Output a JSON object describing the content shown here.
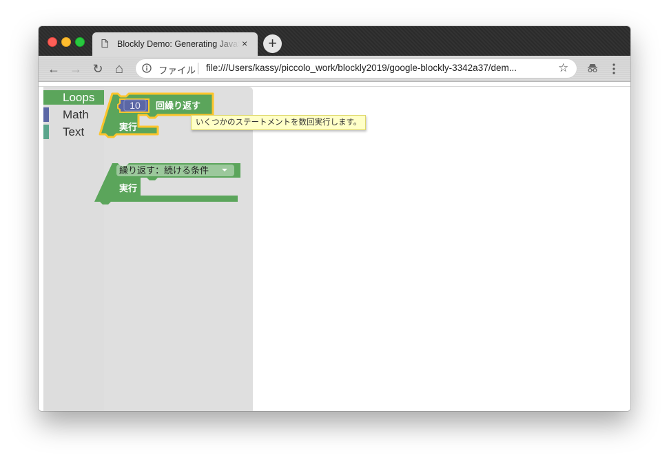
{
  "browser": {
    "tab": {
      "title": "Blockly Demo: Generating JavaScript",
      "close_glyph": "×",
      "icon": "document-icon"
    },
    "new_tab_glyph": "+",
    "toolbar": {
      "back_glyph": "←",
      "forward_glyph": "→",
      "reload_glyph": "↻",
      "home_glyph": "⌂",
      "omnibox": {
        "scheme_label": "ファイル",
        "url": "file:///Users/kassy/piccolo_work/blockly2019/google-blockly-3342a37/dem..."
      },
      "bookmark_glyph": "☆",
      "extension_icon": "incognito-icon",
      "menu_icon": "kebab-menu-icon"
    }
  },
  "toolbox": {
    "categories": [
      {
        "label": "Loops",
        "color": "#5ba55b",
        "selected": true
      },
      {
        "label": "Math",
        "color": "#5b67a5",
        "selected": false
      },
      {
        "label": "Text",
        "color": "#5ba58c",
        "selected": false
      }
    ]
  },
  "flyout": {
    "repeat_block": {
      "times_value": "10",
      "label": "回繰り返す",
      "do_label": "実行",
      "color": "#5ba55b",
      "highlight_color": "#fcc52c"
    },
    "while_block": {
      "mode_option": "繰り返す：続ける条件",
      "do_label": "実行",
      "color": "#5ba55b"
    },
    "number_shadow_color": "#5b67a5"
  },
  "tooltip": {
    "text": "いくつかのステートメントを数回実行します。"
  }
}
